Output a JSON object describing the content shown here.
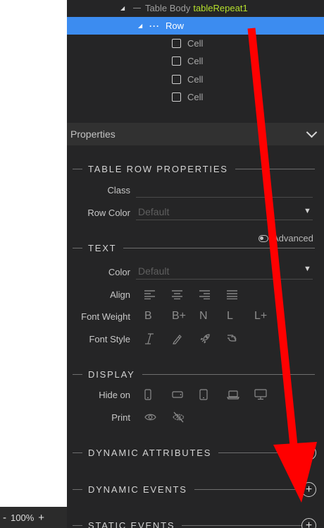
{
  "status_bar": {
    "minus": "-",
    "zoom": "100%",
    "plus": "+"
  },
  "tree": {
    "table_body": {
      "label": "Table Body",
      "id": "tableRepeat1"
    },
    "row": {
      "dots": "···",
      "label": "Row"
    },
    "cells": [
      "Cell",
      "Cell",
      "Cell",
      "Cell"
    ]
  },
  "properties": {
    "title": "Properties",
    "table_row": {
      "heading": "TABLE ROW PROPERTIES",
      "class_label": "Class",
      "class_value": "",
      "row_color_label": "Row Color",
      "row_color_value": "Default"
    },
    "advanced": "Advanced",
    "text": {
      "heading": "TEXT",
      "color_label": "Color",
      "color_value": "Default",
      "align_label": "Align",
      "font_weight_label": "Font Weight",
      "font_weight_options": [
        "B",
        "B+",
        "N",
        "L",
        "L+"
      ],
      "font_style_label": "Font Style"
    },
    "display": {
      "heading": "DISPLAY",
      "hide_on_label": "Hide on",
      "print_label": "Print"
    },
    "dynamic_attributes": "DYNAMIC ATTRIBUTES",
    "dynamic_events": "DYNAMIC EVENTS",
    "static_events": "STATIC EVENTS",
    "plus": "+"
  },
  "colors": {
    "panel_bg": "#252526",
    "selected_row": "#3c8cf0",
    "id_green": "#b6e02c",
    "annotation_arrow": "#ff0000"
  }
}
